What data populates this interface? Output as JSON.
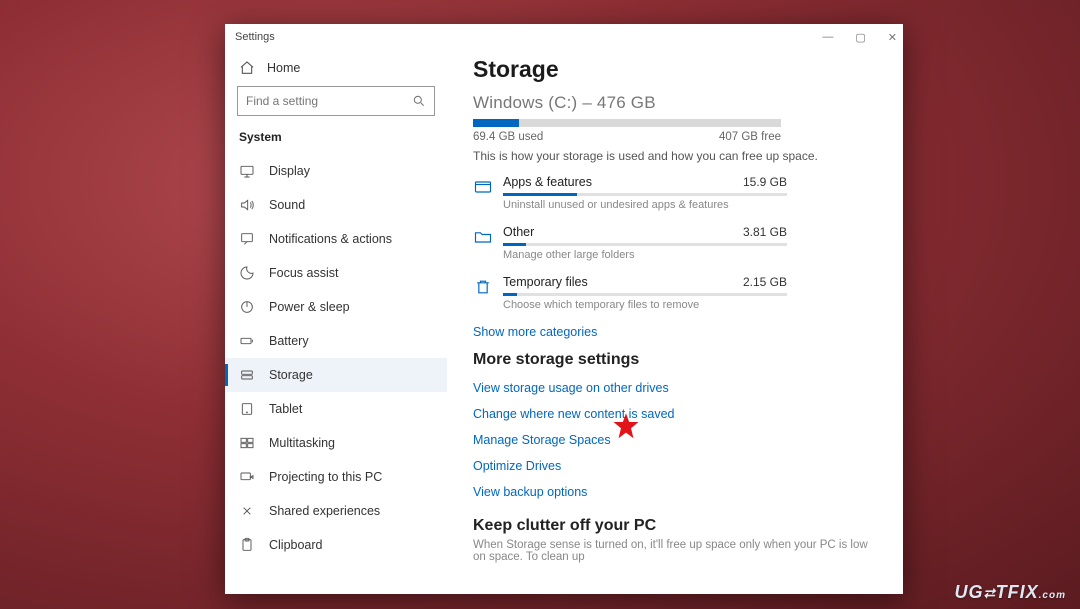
{
  "window": {
    "title": "Settings"
  },
  "controls": {
    "min": "—",
    "max": "▢",
    "close": "✕"
  },
  "home": {
    "label": "Home"
  },
  "search": {
    "placeholder": "Find a setting"
  },
  "category": {
    "label": "System"
  },
  "sidebar": {
    "items": [
      {
        "label": "Display"
      },
      {
        "label": "Sound"
      },
      {
        "label": "Notifications & actions"
      },
      {
        "label": "Focus assist"
      },
      {
        "label": "Power & sleep"
      },
      {
        "label": "Battery"
      },
      {
        "label": "Storage"
      },
      {
        "label": "Tablet"
      },
      {
        "label": "Multitasking"
      },
      {
        "label": "Projecting to this PC"
      },
      {
        "label": "Shared experiences"
      },
      {
        "label": "Clipboard"
      }
    ]
  },
  "page": {
    "title": "Storage",
    "drive_label": "Windows (C:) – 476 GB",
    "used": "69.4 GB used",
    "free": "407 GB free",
    "used_pct": 15,
    "description": "This is how your storage is used and how you can free up space.",
    "categories": [
      {
        "name": "Apps & features",
        "size": "15.9 GB",
        "sub": "Uninstall unused or undesired apps & features",
        "pct": 26
      },
      {
        "name": "Other",
        "size": "3.81 GB",
        "sub": "Manage other large folders",
        "pct": 8
      },
      {
        "name": "Temporary files",
        "size": "2.15 GB",
        "sub": "Choose which temporary files to remove",
        "pct": 5
      }
    ],
    "show_more": "Show more categories",
    "more_header": "More storage settings",
    "links": [
      "View storage usage on other drives",
      "Change where new content is saved",
      "Manage Storage Spaces",
      "Optimize Drives",
      "View backup options"
    ],
    "keep_header": "Keep clutter off your PC",
    "keep_text": "When Storage sense is turned on, it'll free up space only when your PC is low on space. To clean up"
  },
  "watermark": "UG☃TFIX",
  "watermark_plain": "UGETFIX"
}
